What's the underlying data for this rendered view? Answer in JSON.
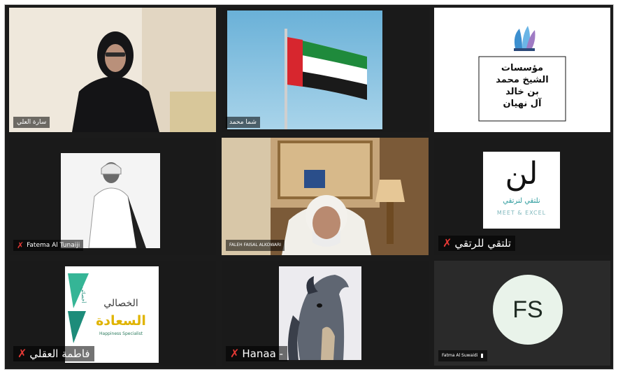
{
  "participants": [
    {
      "id": "p1",
      "name": "سارة العلي"
    },
    {
      "id": "p2",
      "name": "شما محمد"
    },
    {
      "id": "p3",
      "name": ""
    },
    {
      "id": "p4",
      "name": "Fatema Al Tunaiji"
    },
    {
      "id": "p5",
      "name": "FALEH FAISAL ALKOWARI"
    },
    {
      "id": "p6",
      "name": "تلتقي للرتقي"
    },
    {
      "id": "p7",
      "name": "فاطمة العقلي"
    },
    {
      "id": "p8",
      "name": "Hanaa -"
    },
    {
      "id": "p9",
      "name": "Fatma Al Suwaidi",
      "initials": "FS"
    }
  ],
  "foundation_logo": {
    "lines": [
      "مؤسسات",
      "الشيخ محمد",
      "بن خالد",
      "آل نهيان"
    ]
  },
  "nelteqi_logo": {
    "script": "لن",
    "sub": "نلتقي لنرتقي",
    "latin": "MEET & EXCEL"
  },
  "happiness_logo": {
    "line1": "الخصالي",
    "line2": "السعادة",
    "line3": "Happiness Specialist",
    "side": "أخصائي"
  },
  "colors": {
    "mute": "#e53935",
    "circle_bg": "#e9f3ea",
    "tile_bg": "#1f1f1f"
  }
}
